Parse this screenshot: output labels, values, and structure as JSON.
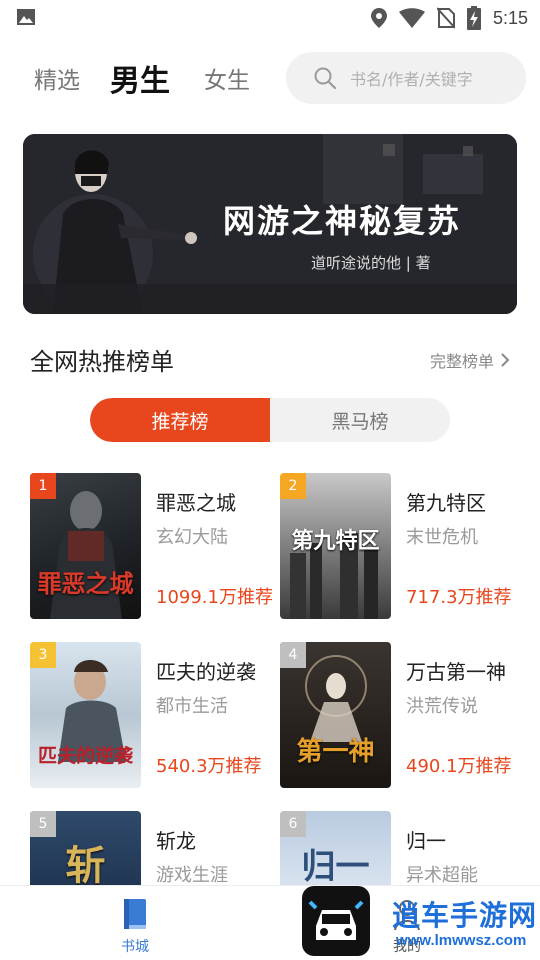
{
  "status_bar": {
    "time": "5:15",
    "left_icon": "image-icon",
    "icons": [
      "location-icon",
      "wifi-icon",
      "no-sim-icon",
      "battery-charging-icon"
    ]
  },
  "header": {
    "tabs": [
      {
        "label": "精选",
        "active": false
      },
      {
        "label": "男生",
        "active": true
      },
      {
        "label": "女生",
        "active": false
      }
    ],
    "search": {
      "placeholder": "书名/作者/关键字",
      "icon": "search-icon"
    }
  },
  "banner": {
    "title": "网游之神秘复苏",
    "author": "道听途说的他 | 著"
  },
  "ranking": {
    "title": "全网热推榜单",
    "more_label": "完整榜单",
    "segments": [
      {
        "label": "推荐榜",
        "active": true
      },
      {
        "label": "黑马榜",
        "active": false
      }
    ],
    "books": [
      {
        "rank": "1",
        "name": "罪恶之城",
        "category": "玄幻大陆",
        "recommend": "1099.1万推荐",
        "cover_title": "罪恶之城"
      },
      {
        "rank": "2",
        "name": "第九特区",
        "category": "末世危机",
        "recommend": "717.3万推荐",
        "cover_title": "第九特区"
      },
      {
        "rank": "3",
        "name": "匹夫的逆袭",
        "category": "都市生活",
        "recommend": "540.3万推荐",
        "cover_title": "匹夫的逆袭"
      },
      {
        "rank": "4",
        "name": "万古第一神",
        "category": "洪荒传说",
        "recommend": "490.1万推荐",
        "cover_title": "第一神"
      },
      {
        "rank": "5",
        "name": "斩龙",
        "category": "游戏生涯",
        "recommend": "",
        "cover_title": "斩"
      },
      {
        "rank": "6",
        "name": "归一",
        "category": "异术超能",
        "recommend": "",
        "cover_title": "归一"
      }
    ]
  },
  "bottom_nav": {
    "items": [
      {
        "label": "书城",
        "icon": "book-icon",
        "active": true
      },
      {
        "label": "我的",
        "icon": "person-icon",
        "active": false
      }
    ]
  },
  "watermark": {
    "text": "逍车手游网",
    "url": "www.lmwwsz.com"
  },
  "colors": {
    "accent": "#e8471d",
    "badge": "#f5a623",
    "nav_active": "#3a7bd5"
  }
}
